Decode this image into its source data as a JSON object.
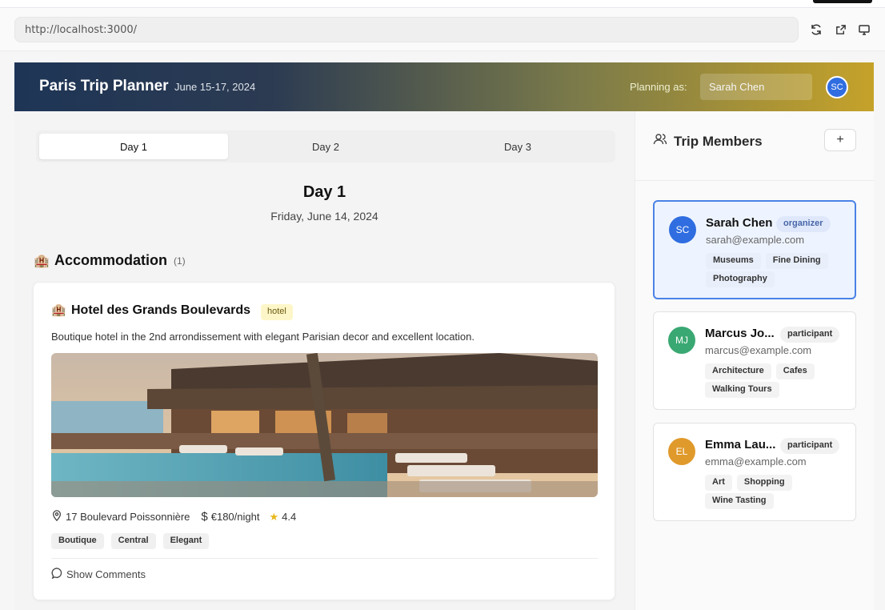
{
  "browser": {
    "url": "http://localhost:3000/"
  },
  "header": {
    "title": "Paris Trip Planner",
    "dates": "June 15-17, 2024",
    "planning_label": "Planning as:",
    "user_value": "Sarah Chen",
    "avatar_initials": "SC"
  },
  "tabs": [
    {
      "label": "Day 1",
      "active": true
    },
    {
      "label": "Day 2",
      "active": false
    },
    {
      "label": "Day 3",
      "active": false
    }
  ],
  "day": {
    "title": "Day 1",
    "date": "Friday, June 14, 2024"
  },
  "accommodation": {
    "section_title": "Accommodation",
    "count": "(1)",
    "hotel": {
      "name": "Hotel des Grands Boulevards",
      "type_badge": "hotel",
      "description": "Boutique hotel in the 2nd arrondissement with elegant Parisian decor and excellent location.",
      "address": "17 Boulevard Poissonnière",
      "price": "€180/night",
      "rating": "4.4",
      "tags": [
        "Boutique",
        "Central",
        "Elegant"
      ],
      "comments_label": "Show Comments"
    }
  },
  "members_panel": {
    "title": "Trip Members",
    "add_label": "+",
    "members": [
      {
        "initials": "SC",
        "name": "Sarah Chen",
        "role": "organizer",
        "email": "sarah@example.com",
        "tags": [
          "Museums",
          "Fine Dining",
          "Photography"
        ],
        "color": "#2f6de0"
      },
      {
        "initials": "MJ",
        "name": "Marcus Jo...",
        "role": "participant",
        "email": "marcus@example.com",
        "tags": [
          "Architecture",
          "Cafes",
          "Walking Tours"
        ],
        "color": "#3aa872"
      },
      {
        "initials": "EL",
        "name": "Emma Lau...",
        "role": "participant",
        "email": "emma@example.com",
        "tags": [
          "Art",
          "Shopping",
          "Wine Tasting"
        ],
        "color": "#e09a2b"
      }
    ]
  }
}
